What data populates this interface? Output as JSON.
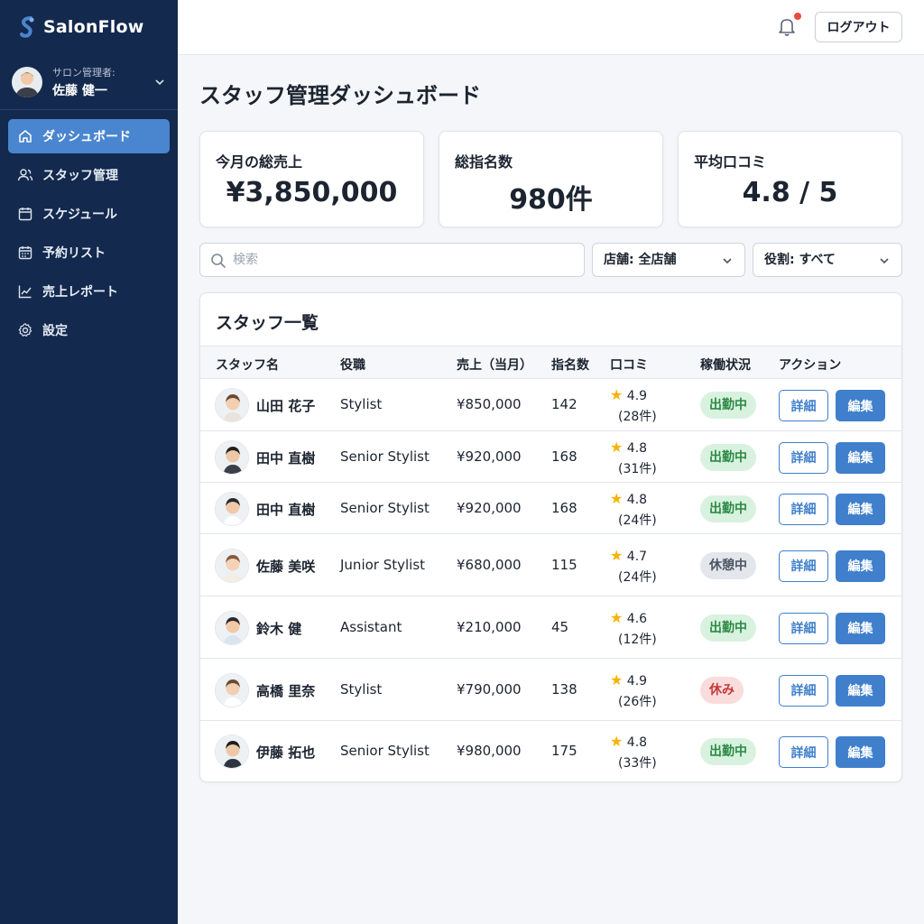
{
  "brand": {
    "name": "SalonFlow"
  },
  "user": {
    "role_label": "サロン管理者:",
    "name": "佐藤 健一"
  },
  "nav": [
    {
      "label": "ダッシュボード",
      "icon": "home-icon",
      "active": true
    },
    {
      "label": "スタッフ管理",
      "icon": "users-icon",
      "active": false
    },
    {
      "label": "スケジュール",
      "icon": "calendar-icon",
      "active": false
    },
    {
      "label": "予約リスト",
      "icon": "calendar-grid-icon",
      "active": false
    },
    {
      "label": "売上レポート",
      "icon": "chart-line-icon",
      "active": false
    },
    {
      "label": "設定",
      "icon": "gear-icon",
      "active": false
    }
  ],
  "topbar": {
    "logout_label": "ログアウト"
  },
  "page": {
    "title": "スタッフ管理ダッシュボード"
  },
  "stats": [
    {
      "label": "今月の総売上",
      "value": "¥3,850,000"
    },
    {
      "label": "総指名数",
      "value": "980件"
    },
    {
      "label": "平均口コミ",
      "value": "4.8 / 5"
    }
  ],
  "filters": {
    "search_placeholder": "検索",
    "store_select": "店舗: 全店舗",
    "role_select": "役割: すべて"
  },
  "table": {
    "title": "スタッフ一覧",
    "columns": [
      "スタッフ名",
      "役職",
      "売上（当月）",
      "指名数",
      "口コミ",
      "稼働状況",
      "アクション"
    ],
    "detail_label": "詳細",
    "edit_label": "編集",
    "rows": [
      {
        "name": "山田 花子",
        "role": "Stylist",
        "sales": "¥850,000",
        "nominations": "142",
        "rating": "4.9",
        "reviews": "(28件)",
        "status": "出勤中",
        "status_type": "working"
      },
      {
        "name": "田中 直樹",
        "role": "Senior Stylist",
        "sales": "¥920,000",
        "nominations": "168",
        "rating": "4.8",
        "reviews": "(31件)",
        "status": "出勤中",
        "status_type": "working"
      },
      {
        "name": "田中 直樹",
        "role": "Senior Stylist",
        "sales": "¥920,000",
        "nominations": "168",
        "rating": "4.8",
        "reviews": "(24件)",
        "status": "出勤中",
        "status_type": "working"
      },
      {
        "name": "佐藤 美咲",
        "role": "Junior Stylist",
        "sales": "¥680,000",
        "nominations": "115",
        "rating": "4.7",
        "reviews": "(24件)",
        "status": "休憩中",
        "status_type": "break"
      },
      {
        "name": "鈴木 健",
        "role": "Assistant",
        "sales": "¥210,000",
        "nominations": "45",
        "rating": "4.6",
        "reviews": "(12件)",
        "status": "出勤中",
        "status_type": "working"
      },
      {
        "name": "高橋 里奈",
        "role": "Stylist",
        "sales": "¥790,000",
        "nominations": "138",
        "rating": "4.9",
        "reviews": "(26件)",
        "status": "休み",
        "status_type": "off"
      },
      {
        "name": "伊藤 拓也",
        "role": "Senior Stylist",
        "sales": "¥980,000",
        "nominations": "175",
        "rating": "4.8",
        "reviews": "(33件)",
        "status": "出勤中",
        "status_type": "working"
      }
    ]
  },
  "colors": {
    "sidebar_bg": "#13294d",
    "accent": "#3f7fcb",
    "working": "#2c8a45",
    "break": "#4b5563",
    "off": "#c43a3a",
    "star": "#f5b400"
  }
}
